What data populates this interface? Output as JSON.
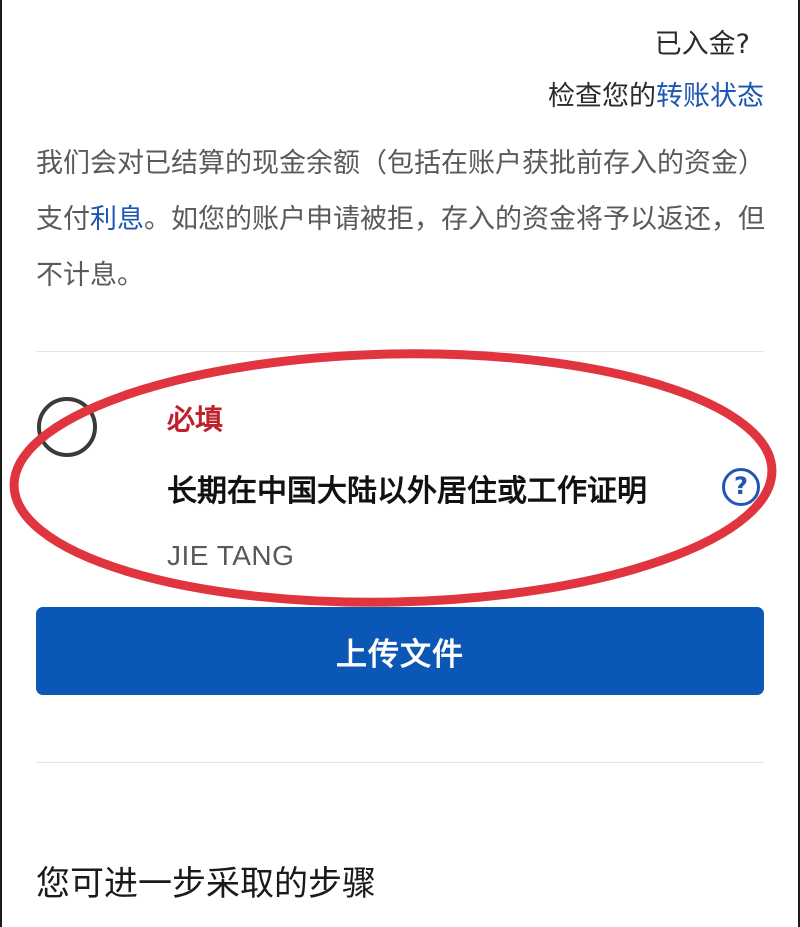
{
  "deposit_status": {
    "question": "已入金?",
    "check_prefix": "检查您的",
    "transfer_link": "转账状态"
  },
  "interest_note": {
    "part1": "我们会对已结算的现金余额（包括在账户获批前存入的资金）支付",
    "interest_link": "利息",
    "part2": "。如您的账户申请被拒，存入的资金将予以返还，但不计息。"
  },
  "requirement": {
    "required_label": "必填",
    "document_title": "长期在中国大陆以外居住或工作证明",
    "help_icon_glyph": "?",
    "person_name": "JIE TANG"
  },
  "upload": {
    "button_label": "上传文件"
  },
  "next_steps": {
    "heading": "您可进一步采取的步骤"
  },
  "colors": {
    "link": "#1e56b3",
    "required": "#c0202c",
    "button": "#0b57b5",
    "annotation": "#e0353f"
  },
  "icons": {
    "status": "empty-circle-icon",
    "help": "question-circle-icon"
  }
}
